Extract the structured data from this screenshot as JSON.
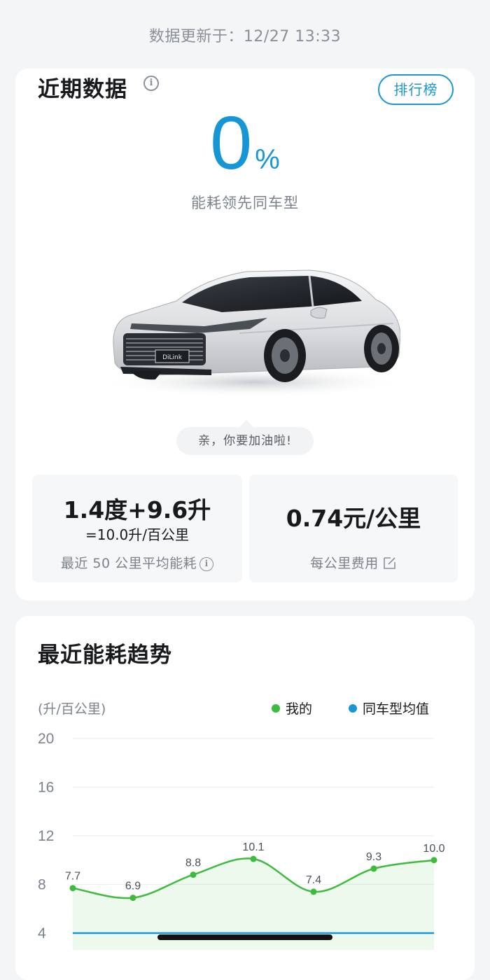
{
  "header": {
    "update_time": "数据更新于：12/27 13:33"
  },
  "recent": {
    "title": "近期数据",
    "rank_button": "排行榜",
    "lead_percent": "0",
    "percent_unit": "%",
    "lead_text": "能耗领先同车型",
    "bubble_text": "亲，你要加油啦!",
    "energy": {
      "main": "1.4度+9.6升",
      "sub": "=10.0升/百公里",
      "caption": "最近 50 公里平均能耗"
    },
    "cost": {
      "main": "0.74元/公里",
      "caption": "每公里费用"
    }
  },
  "trend": {
    "title": "最近能耗趋势",
    "unit_label": "(升/百公里)",
    "legend_mine": "我的",
    "legend_avg": "同车型均值"
  },
  "colors": {
    "accent": "#1796d6",
    "mine": "#3dbb3d",
    "avg": "#1a96d4"
  },
  "icons": {
    "info": "info-icon",
    "edit": "edit-icon"
  },
  "chart_data": {
    "type": "line",
    "title": "最近能耗趋势",
    "ylabel": "(升/百公里)",
    "y_ticks": [
      20,
      16,
      12,
      8,
      4
    ],
    "ylim": [
      4,
      20
    ],
    "grid": true,
    "legend": "top-right",
    "series": [
      {
        "name": "我的",
        "values": [
          7.7,
          6.9,
          8.8,
          10.1,
          7.4,
          9.3,
          10.0
        ],
        "labels": [
          "7.7",
          "6.9",
          "8.8",
          "10.1",
          "7.4",
          "9.3",
          "10.0"
        ]
      },
      {
        "name": "同车型均值",
        "values": [
          4.0,
          4.0,
          4.0,
          4.0,
          4.0,
          4.0,
          4.0
        ]
      }
    ]
  }
}
